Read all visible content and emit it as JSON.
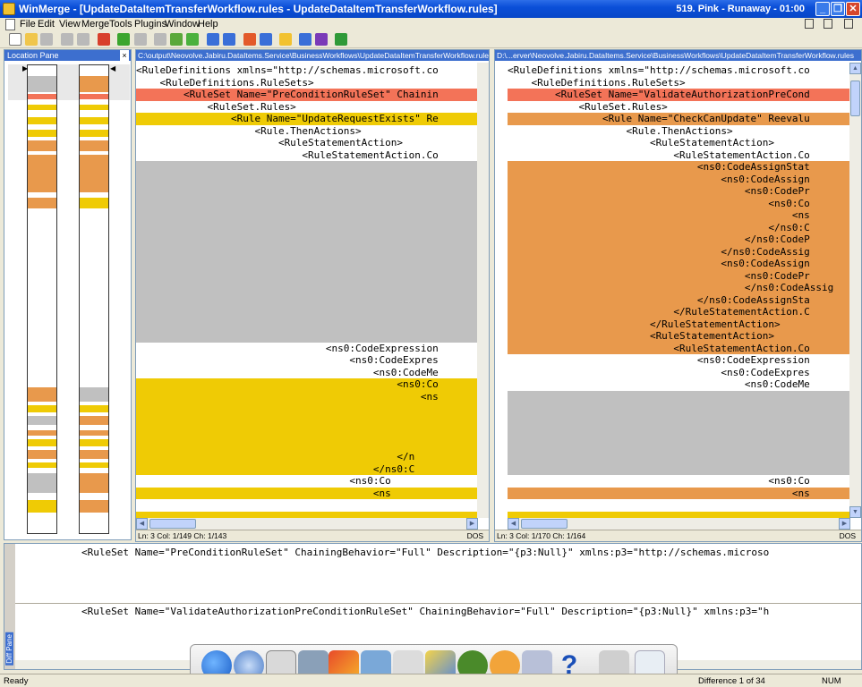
{
  "window": {
    "title": "WinMerge - [UpdateDataItemTransferWorkflow.rules - UpdateDataItemTransferWorkflow.rules]",
    "now_playing": "519. Pink - Runaway - 01:00"
  },
  "menu": [
    "File",
    "Edit",
    "View",
    "Merge",
    "Tools",
    "Plugins",
    "Window",
    "Help"
  ],
  "location_pane": {
    "title": "Location Pane",
    "close": "×"
  },
  "left_pane": {
    "path": "C:\\output\\Neovolve.Jabiru.DataItems.Service\\BusinessWorkflows\\UpdateDataItemTransferWorkflow.rules",
    "lines": [
      "<RuleDefinitions xmlns=\"http://schemas.microsoft.co",
      "    <RuleDefinitions.RuleSets>",
      "        <RuleSet Name=\"PreConditionRuleSet\" Chainin",
      "            <RuleSet.Rules>",
      "                <Rule Name=\"UpdateRequestExists\" Re",
      "                    <Rule.ThenActions>",
      "                        <RuleStatementAction>",
      "                            <RuleStatementAction.Co",
      "",
      "",
      "",
      "",
      "",
      "",
      "",
      "",
      "",
      "",
      "",
      "",
      "",
      "",
      "",
      "                                <ns0:CodeExpression",
      "                                    <ns0:CodeExpres",
      "                                        <ns0:CodeMe",
      "                                            <ns0:Co",
      "                                                <ns",
      "",
      "",
      "",
      "",
      "                                            </n",
      "                                        </ns0:C",
      "                                    <ns0:Co",
      "                                        <ns",
      "",
      ""
    ],
    "status": "Ln: 3  Col: 1/149  Ch: 1/143",
    "eol": "DOS"
  },
  "right_pane": {
    "path": "D:\\...erver\\Neovolve.Jabiru.DataItems.Service\\BusinessWorkflows\\UpdateDataItemTransferWorkflow.rules",
    "lines": [
      "<RuleDefinitions xmlns=\"http://schemas.microsoft.co",
      "    <RuleDefinitions.RuleSets>",
      "        <RuleSet Name=\"ValidateAuthorizationPreCond",
      "            <RuleSet.Rules>",
      "                <Rule Name=\"CheckCanUpdate\" Reevalu",
      "                    <Rule.ThenActions>",
      "                        <RuleStatementAction>",
      "                            <RuleStatementAction.Co",
      "                                <ns0:CodeAssignStat",
      "                                    <ns0:CodeAssign",
      "                                        <ns0:CodePr",
      "                                            <ns0:Co",
      "                                                <ns",
      "                                            </ns0:C",
      "                                        </ns0:CodeP",
      "                                    </ns0:CodeAssig",
      "                                    <ns0:CodeAssign",
      "                                        <ns0:CodePr",
      "                                        </ns0:CodeAssig",
      "                                </ns0:CodeAssignSta",
      "                            </RuleStatementAction.C",
      "                        </RuleStatementAction>",
      "                        <RuleStatementAction>",
      "                            <RuleStatementAction.Co",
      "                                <ns0:CodeExpression",
      "                                    <ns0:CodeExpres",
      "                                        <ns0:CodeMe",
      "",
      "",
      "",
      "",
      "",
      "",
      "",
      "                                            <ns0:Co",
      "                                                <ns",
      "",
      ""
    ],
    "status": "Ln: 3  Col: 1/170  Ch: 1/164",
    "eol": "DOS"
  },
  "diff_pane": {
    "label": "Diff Pane",
    "left_line": "<RuleSet Name=\"PreConditionRuleSet\" ChainingBehavior=\"Full\" Description=\"{p3:Null}\" xmlns:p3=\"http://schemas.microso",
    "right_line": "<RuleSet Name=\"ValidateAuthorizationPreConditionRuleSet\" ChainingBehavior=\"Full\" Description=\"{p3:Null}\" xmlns:p3=\"h"
  },
  "statusbar": {
    "ready": "Ready",
    "difference": "Difference 1 of 34",
    "num": "NUM"
  },
  "colors": {
    "selected_diff": "#f37358",
    "diff": "#efcb05",
    "changed": "#e8994c",
    "missing": "#c0c0c0",
    "title": "#0b4fd8"
  }
}
